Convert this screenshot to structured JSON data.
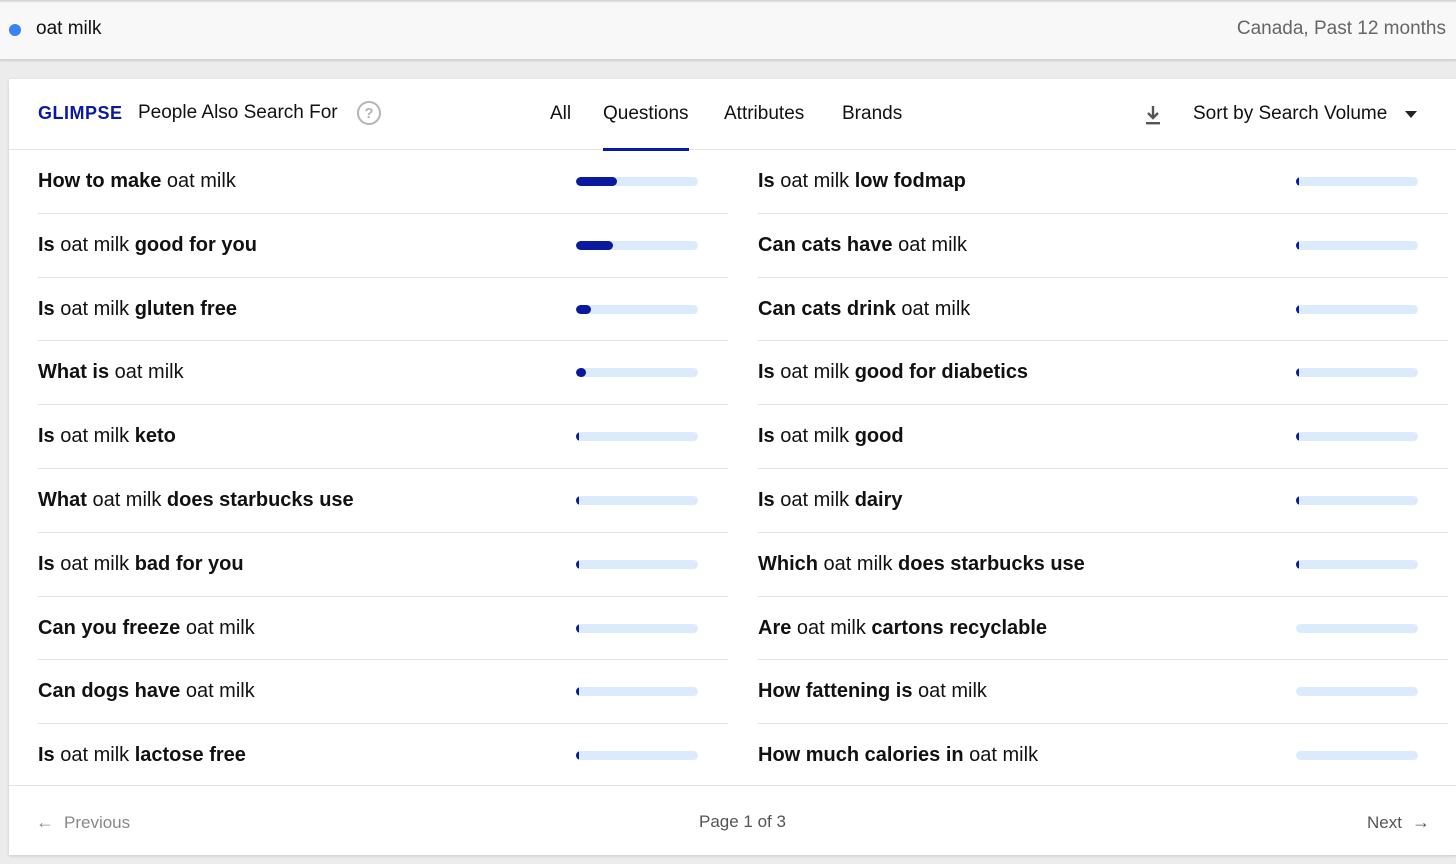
{
  "search": {
    "query": "oat milk",
    "scope": "Canada, Past 12 months",
    "dot_color": "#3b82f6"
  },
  "panel": {
    "logo": "GLIMPSE",
    "logo_color": "#0a1a9e",
    "title": "People Also Search For",
    "help_icon": "?",
    "tabs": [
      {
        "label": "All",
        "active": false
      },
      {
        "label": "Questions",
        "active": true
      },
      {
        "label": "Attributes",
        "active": false
      },
      {
        "label": "Brands",
        "active": false
      }
    ],
    "sort_label": "Sort by Search Volume",
    "bar_color": "#0a1a9e",
    "track_color": "#dcebfb"
  },
  "questions_left": [
    {
      "parts": [
        {
          "t": "How to make",
          "b": true
        },
        {
          "t": " oat milk",
          "b": false
        }
      ],
      "volume": 0.34
    },
    {
      "parts": [
        {
          "t": "Is",
          "b": true
        },
        {
          "t": " oat milk ",
          "b": false
        },
        {
          "t": "good for you",
          "b": true
        }
      ],
      "volume": 0.3
    },
    {
      "parts": [
        {
          "t": "Is",
          "b": true
        },
        {
          "t": " oat milk ",
          "b": false
        },
        {
          "t": "gluten free",
          "b": true
        }
      ],
      "volume": 0.12
    },
    {
      "parts": [
        {
          "t": "What is",
          "b": true
        },
        {
          "t": " oat milk",
          "b": false
        }
      ],
      "volume": 0.08
    },
    {
      "parts": [
        {
          "t": "Is",
          "b": true
        },
        {
          "t": " oat milk ",
          "b": false
        },
        {
          "t": "keto",
          "b": true
        }
      ],
      "volume": 0.025
    },
    {
      "parts": [
        {
          "t": "What",
          "b": true
        },
        {
          "t": " oat milk ",
          "b": false
        },
        {
          "t": "does starbucks use",
          "b": true
        }
      ],
      "volume": 0.025
    },
    {
      "parts": [
        {
          "t": "Is",
          "b": true
        },
        {
          "t": " oat milk ",
          "b": false
        },
        {
          "t": "bad for you",
          "b": true
        }
      ],
      "volume": 0.02
    },
    {
      "parts": [
        {
          "t": "Can you freeze",
          "b": true
        },
        {
          "t": " oat milk",
          "b": false
        }
      ],
      "volume": 0.02
    },
    {
      "parts": [
        {
          "t": "Can dogs have",
          "b": true
        },
        {
          "t": " oat milk",
          "b": false
        }
      ],
      "volume": 0.02
    },
    {
      "parts": [
        {
          "t": "Is",
          "b": true
        },
        {
          "t": " oat milk ",
          "b": false
        },
        {
          "t": "lactose free",
          "b": true
        }
      ],
      "volume": 0.02
    }
  ],
  "questions_right": [
    {
      "parts": [
        {
          "t": "Is",
          "b": true
        },
        {
          "t": " oat milk ",
          "b": false
        },
        {
          "t": "low fodmap",
          "b": true
        }
      ],
      "volume": 0.015
    },
    {
      "parts": [
        {
          "t": "Can cats have",
          "b": true
        },
        {
          "t": " oat milk",
          "b": false
        }
      ],
      "volume": 0.015
    },
    {
      "parts": [
        {
          "t": "Can cats drink",
          "b": true
        },
        {
          "t": " oat milk",
          "b": false
        }
      ],
      "volume": 0.015
    },
    {
      "parts": [
        {
          "t": "Is",
          "b": true
        },
        {
          "t": " oat milk ",
          "b": false
        },
        {
          "t": "good for diabetics",
          "b": true
        }
      ],
      "volume": 0.015
    },
    {
      "parts": [
        {
          "t": "Is",
          "b": true
        },
        {
          "t": " oat milk ",
          "b": false
        },
        {
          "t": "good",
          "b": true
        }
      ],
      "volume": 0.015
    },
    {
      "parts": [
        {
          "t": "Is",
          "b": true
        },
        {
          "t": " oat milk ",
          "b": false
        },
        {
          "t": "dairy",
          "b": true
        }
      ],
      "volume": 0.015
    },
    {
      "parts": [
        {
          "t": "Which",
          "b": true
        },
        {
          "t": " oat milk ",
          "b": false
        },
        {
          "t": "does starbucks use",
          "b": true
        }
      ],
      "volume": 0.015
    },
    {
      "parts": [
        {
          "t": "Are",
          "b": true
        },
        {
          "t": " oat milk ",
          "b": false
        },
        {
          "t": "cartons recyclable",
          "b": true
        }
      ],
      "volume": 0
    },
    {
      "parts": [
        {
          "t": "How fattening is",
          "b": true
        },
        {
          "t": " oat milk",
          "b": false
        }
      ],
      "volume": 0
    },
    {
      "parts": [
        {
          "t": "How much calories in",
          "b": true
        },
        {
          "t": " oat milk",
          "b": false
        }
      ],
      "volume": 0
    }
  ],
  "pagination": {
    "prev": "Previous",
    "page": "Page 1 of 3",
    "next": "Next"
  }
}
